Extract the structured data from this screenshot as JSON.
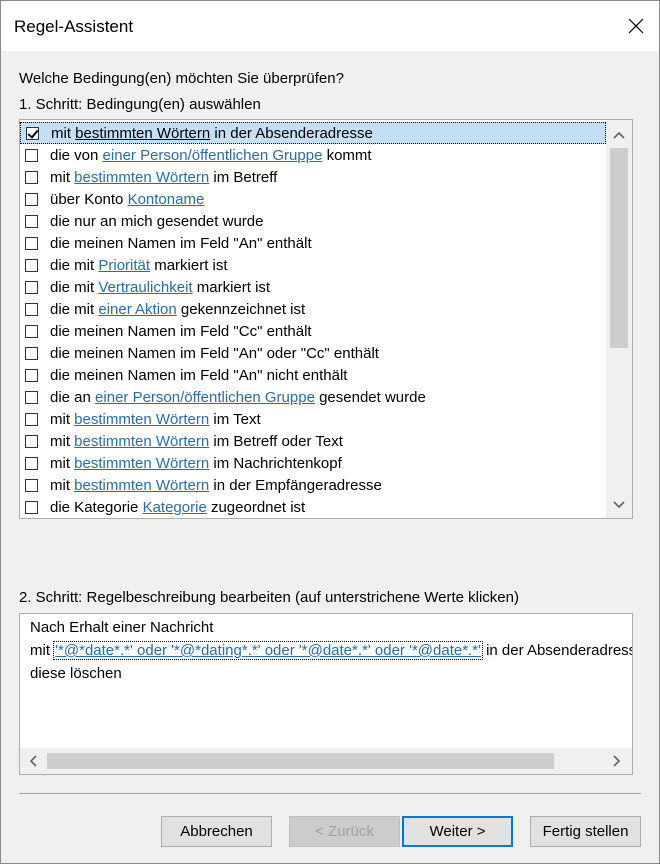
{
  "window": {
    "title": "Regel-Assistent"
  },
  "question": "Welche Bedingung(en) möchten Sie überprüfen?",
  "step1_label": "1. Schritt: Bedingung(en) auswählen",
  "conditions": [
    {
      "checked": true,
      "selected": true,
      "parts": [
        {
          "t": "mit "
        },
        {
          "t": "bestimmten Wörtern",
          "link": true
        },
        {
          "t": " in der Absenderadresse"
        }
      ]
    },
    {
      "checked": false,
      "selected": false,
      "parts": [
        {
          "t": "die von "
        },
        {
          "t": "einer Person/öffentlichen Gruppe",
          "link": true
        },
        {
          "t": " kommt"
        }
      ]
    },
    {
      "checked": false,
      "selected": false,
      "parts": [
        {
          "t": "mit "
        },
        {
          "t": "bestimmten Wörtern",
          "link": true
        },
        {
          "t": " im Betreff"
        }
      ]
    },
    {
      "checked": false,
      "selected": false,
      "parts": [
        {
          "t": "über Konto "
        },
        {
          "t": "Kontoname",
          "link": true
        }
      ]
    },
    {
      "checked": false,
      "selected": false,
      "parts": [
        {
          "t": "die nur an mich gesendet wurde"
        }
      ]
    },
    {
      "checked": false,
      "selected": false,
      "parts": [
        {
          "t": "die meinen Namen im Feld \"An\" enthält"
        }
      ]
    },
    {
      "checked": false,
      "selected": false,
      "parts": [
        {
          "t": "die mit "
        },
        {
          "t": "Priorität",
          "link": true
        },
        {
          "t": " markiert ist"
        }
      ]
    },
    {
      "checked": false,
      "selected": false,
      "parts": [
        {
          "t": "die mit "
        },
        {
          "t": "Vertraulichkeit",
          "link": true
        },
        {
          "t": " markiert ist"
        }
      ]
    },
    {
      "checked": false,
      "selected": false,
      "parts": [
        {
          "t": "die mit "
        },
        {
          "t": "einer Aktion",
          "link": true
        },
        {
          "t": " gekennzeichnet ist"
        }
      ]
    },
    {
      "checked": false,
      "selected": false,
      "parts": [
        {
          "t": "die meinen Namen im Feld \"Cc\" enthält"
        }
      ]
    },
    {
      "checked": false,
      "selected": false,
      "parts": [
        {
          "t": "die meinen Namen im Feld \"An\" oder \"Cc\" enthält"
        }
      ]
    },
    {
      "checked": false,
      "selected": false,
      "parts": [
        {
          "t": "die meinen Namen im Feld \"An\" nicht enthält"
        }
      ]
    },
    {
      "checked": false,
      "selected": false,
      "parts": [
        {
          "t": "die an "
        },
        {
          "t": "einer Person/öffentlichen Gruppe",
          "link": true
        },
        {
          "t": " gesendet wurde"
        }
      ]
    },
    {
      "checked": false,
      "selected": false,
      "parts": [
        {
          "t": "mit "
        },
        {
          "t": "bestimmten Wörtern",
          "link": true
        },
        {
          "t": " im Text"
        }
      ]
    },
    {
      "checked": false,
      "selected": false,
      "parts": [
        {
          "t": "mit "
        },
        {
          "t": "bestimmten Wörtern",
          "link": true
        },
        {
          "t": " im Betreff oder Text"
        }
      ]
    },
    {
      "checked": false,
      "selected": false,
      "parts": [
        {
          "t": "mit "
        },
        {
          "t": "bestimmten Wörtern",
          "link": true
        },
        {
          "t": " im Nachrichtenkopf"
        }
      ]
    },
    {
      "checked": false,
      "selected": false,
      "parts": [
        {
          "t": "mit "
        },
        {
          "t": "bestimmten Wörtern",
          "link": true
        },
        {
          "t": " in der Empfängeradresse"
        }
      ]
    },
    {
      "checked": false,
      "selected": false,
      "parts": [
        {
          "t": "die Kategorie "
        },
        {
          "t": "Kategorie",
          "link": true
        },
        {
          "t": " zugeordnet ist"
        }
      ]
    }
  ],
  "step2_label": "2. Schritt: Regelbeschreibung bearbeiten (auf unterstrichene Werte klicken)",
  "description": {
    "line1": "Nach Erhalt einer Nachricht",
    "line2_prefix": "mit ",
    "line2_link": "'*@*date*.*' oder '*@*dating*.*' oder '*@date*.*' oder '*@date*.*'",
    "line2_suffix": " in der Absenderadresse",
    "line3": "diese löschen"
  },
  "buttons": {
    "cancel": "Abbrechen",
    "back": "< Zurück",
    "next": "Weiter >",
    "finish": "Fertig stellen"
  },
  "icons": {
    "close": "close-icon",
    "scroll_up": "chevron-up-icon",
    "scroll_down": "chevron-down-icon",
    "scroll_left": "chevron-left-icon",
    "scroll_right": "chevron-right-icon"
  }
}
